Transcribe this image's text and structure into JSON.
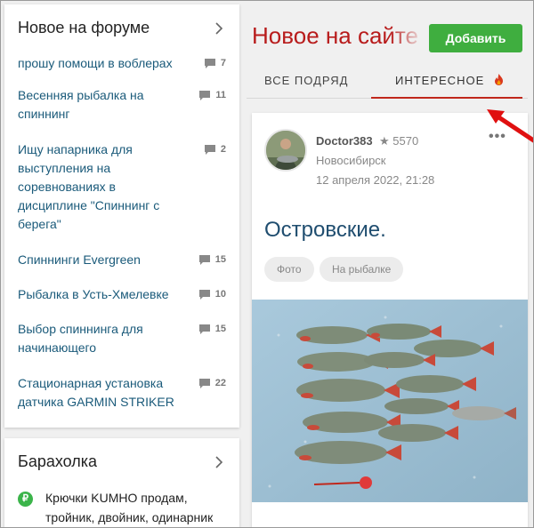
{
  "forum": {
    "title": "Новое на форуме",
    "topics": [
      {
        "title": "прошу помощи в воблерах",
        "count": "7"
      },
      {
        "title": "Весенняя рыбалка на спиннинг",
        "count": "11"
      },
      {
        "title": "Ищу напарника для выступления на соревнованиях в дисциплине \"Спиннинг с берега\"",
        "count": "2"
      },
      {
        "title": "Спиннинги Evergreen",
        "count": "15"
      },
      {
        "title": "Рыбалка в Усть-Хмелевке",
        "count": "10"
      },
      {
        "title": "Выбор спиннинга для начинающего",
        "count": "15"
      },
      {
        "title": "Стационарная установка датчика GARMIN STRIKER",
        "count": "22"
      }
    ]
  },
  "baraholka": {
    "title": "Барахолка",
    "currency_symbol": "₽",
    "item_text": "Крючки KUMHO продам, тройник, двойник, одинарник"
  },
  "site": {
    "title": "Новое на сайте",
    "add_label": "Добавить",
    "tabs": [
      {
        "label": "ВСЕ ПОДРЯД",
        "active": false
      },
      {
        "label": "ИНТЕРЕСНОЕ",
        "active": true
      }
    ]
  },
  "post": {
    "author": "Doctor383",
    "reputation": "★ 5570",
    "city": "Новосибирск",
    "date": "12 апреля 2022, 21:28",
    "more": "•••",
    "title": "Островские.",
    "tags": [
      "Фото",
      "На рыбалке"
    ]
  },
  "icons": {
    "chevron": "chevron-right-icon",
    "comment": "comment-bubble-icon",
    "fire": "fire-icon",
    "ruble": "ruble-icon"
  },
  "colors": {
    "accent_red": "#b81c1c",
    "button_green": "#3fae3f",
    "link_blue": "#1a5a7a",
    "tab_underline": "#c0281c"
  }
}
